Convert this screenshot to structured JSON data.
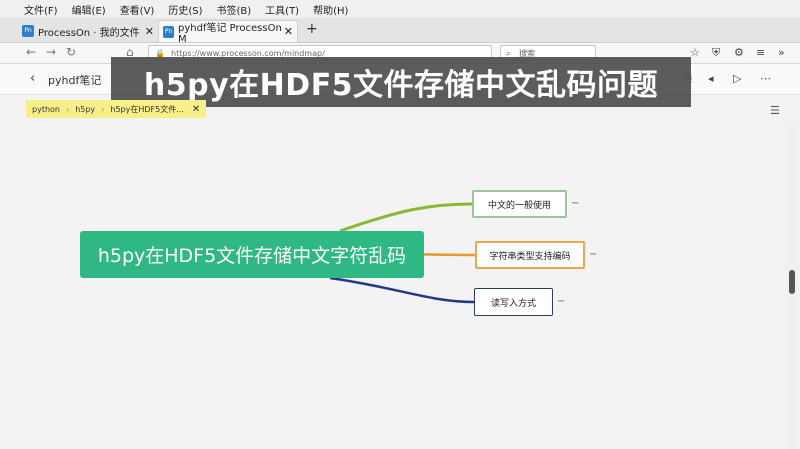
{
  "menu": [
    "文件(F)",
    "编辑(E)",
    "查看(V)",
    "历史(S)",
    "书签(B)",
    "工具(T)",
    "帮助(H)"
  ],
  "tabs": [
    {
      "label": "ProcessOn · 我的文件",
      "favicon": "Pn"
    },
    {
      "label": "pyhdf笔记 ProcessOn M",
      "favicon": "Pn"
    }
  ],
  "nav": {
    "url": "https://www.processon.com/mindmap/",
    "search_placeholder": "搜索"
  },
  "app": {
    "doc_title": "pyhdf笔记"
  },
  "banner": {
    "title": "h5py在HDF5文件存储中文乱码问题"
  },
  "breadcrumb": [
    "python",
    "h5py",
    "h5py在HDF5文件..."
  ],
  "mindmap": {
    "root": "h5py在HDF5文件存储中文字符乱码",
    "children": [
      {
        "label": "中文的一般使用",
        "color": "#9cc49a"
      },
      {
        "label": "字符串类型支持编码",
        "color": "#f0a648"
      },
      {
        "label": "读写入方式",
        "color": "#2a3e5f"
      }
    ]
  },
  "colors": {
    "root": "#2fb884",
    "link1": "#8ab832",
    "link2": "#e69a2e",
    "link3": "#1f3a8c"
  }
}
